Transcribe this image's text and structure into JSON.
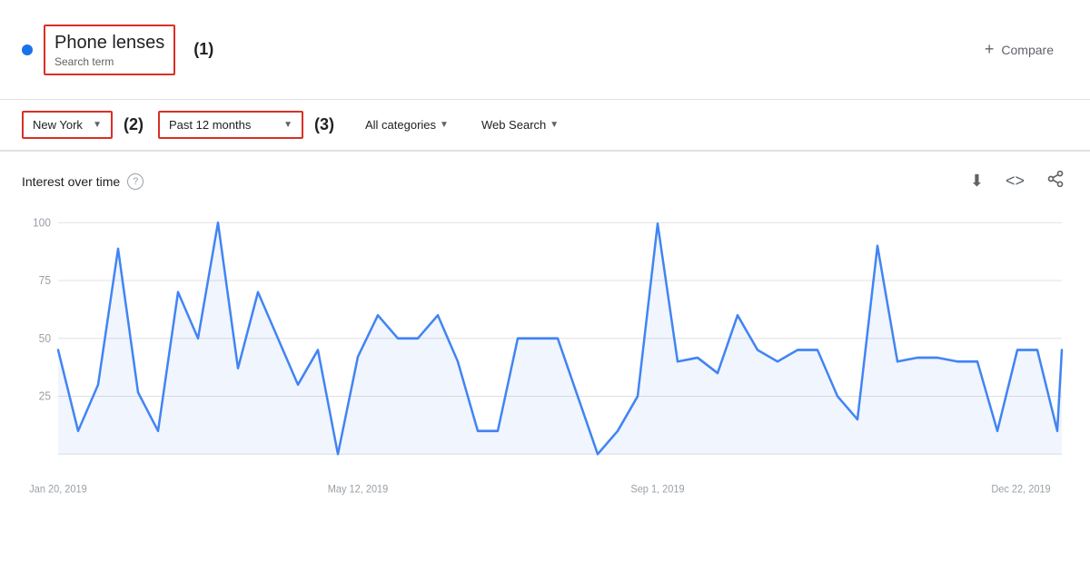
{
  "header": {
    "search_term": "Phone lenses",
    "search_sub": "Search term",
    "annotation": "(1)",
    "compare_label": "Compare"
  },
  "filters": {
    "location": {
      "label": "New York",
      "annotation": "(2)"
    },
    "time_range": {
      "label": "Past 12 months",
      "annotation": "(3)"
    },
    "categories": {
      "label": "All categories"
    },
    "search_type": {
      "label": "Web Search"
    }
  },
  "chart": {
    "title": "Interest over time",
    "x_labels": [
      "Jan 20, 2019",
      "May 12, 2019",
      "Sep 1, 2019",
      "Dec 22, 2019"
    ],
    "y_labels": [
      "100",
      "75",
      "50",
      "25"
    ],
    "data_points": [
      45,
      10,
      30,
      88,
      28,
      10,
      70,
      50,
      100,
      38,
      70,
      50,
      30,
      45,
      0,
      42,
      62,
      50,
      50,
      55,
      35,
      10,
      10,
      50,
      50,
      50,
      25,
      0,
      10,
      25,
      97,
      40,
      42,
      35,
      55,
      45,
      35,
      45,
      45,
      25,
      15,
      85,
      40,
      40,
      40,
      35,
      38,
      10,
      45,
      45,
      10
    ]
  }
}
